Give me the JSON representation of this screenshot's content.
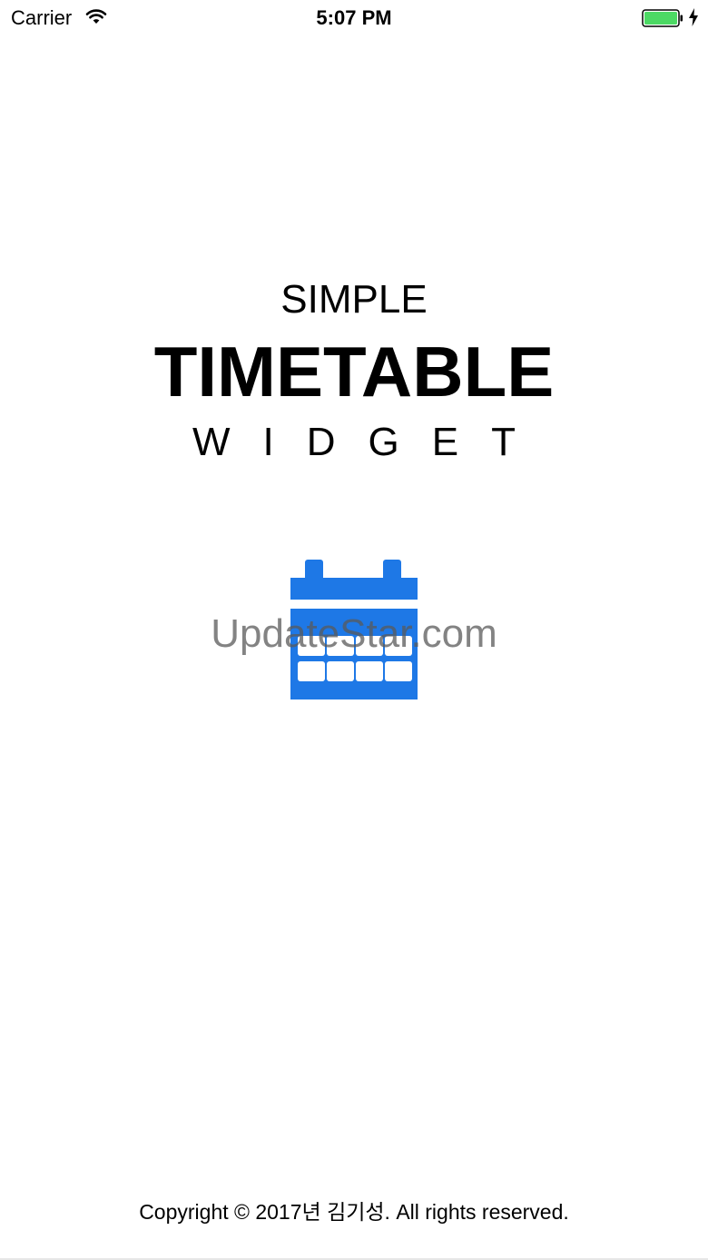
{
  "status_bar": {
    "carrier": "Carrier",
    "time": "5:07 PM",
    "battery_color": "#4cd964"
  },
  "icons": {
    "wifi": "wifi-icon",
    "battery": "battery-icon",
    "charging": "charging-bolt-icon",
    "calendar": "calendar-icon"
  },
  "splash": {
    "line1": "SIMPLE",
    "line2": "TIMETABLE",
    "line3": "WIDGET",
    "accent_color": "#1e78e6"
  },
  "watermark": "UpdateStar.com",
  "footer": {
    "copyright": "Copyright © 2017년 김기성. All rights reserved."
  }
}
